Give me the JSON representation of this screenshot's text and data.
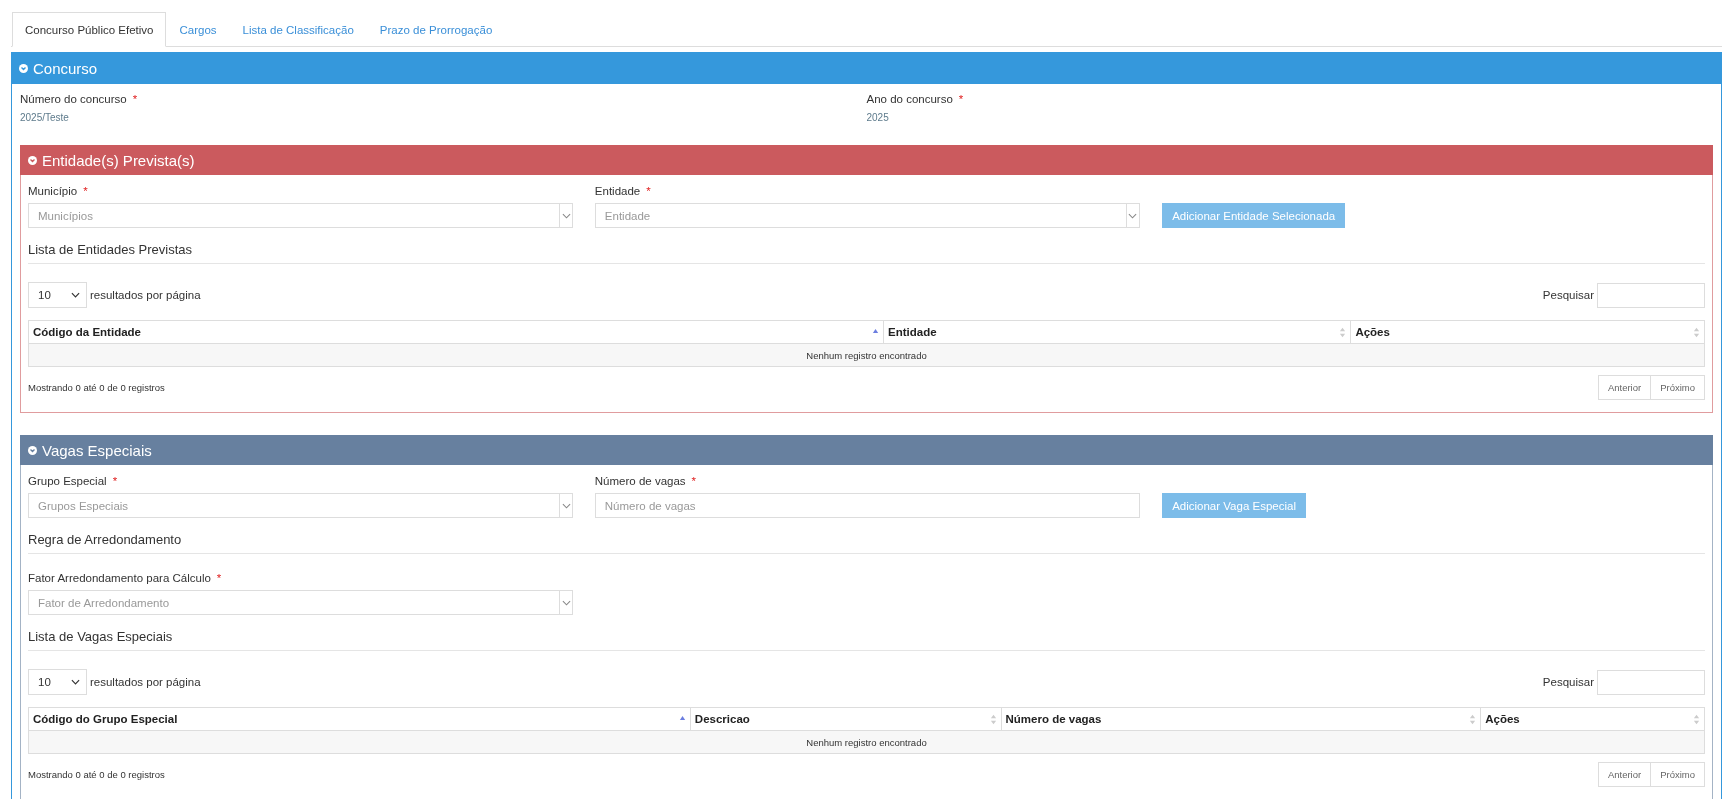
{
  "tabs": [
    {
      "label": "Concurso Público Efetivo",
      "selected": true
    },
    {
      "label": "Cargos",
      "selected": false
    },
    {
      "label": "Lista de Classificação",
      "selected": false
    },
    {
      "label": "Prazo de Prorrogação",
      "selected": false
    }
  ],
  "panel": {
    "title": "Concurso",
    "fields": [
      {
        "label": "Número do concurso",
        "required_mark": "*",
        "value": "2025/Teste"
      },
      {
        "label": "Ano do concurso",
        "required_mark": "*",
        "value": "2025"
      }
    ],
    "subpanels": [
      {
        "title": "Entidade(s) Prevista(s)",
        "color": "#cb5a5e",
        "blocks": [
          {
            "kind": "row",
            "controls": [
              {
                "kind": "select",
                "label": "Município",
                "required_mark": "*",
                "placeholder": "Municípios"
              },
              {
                "kind": "select",
                "label": "Entidade",
                "required_mark": "*",
                "placeholder": "Entidade"
              },
              {
                "kind": "button",
                "label": "Adicionar Entidade Selecionada"
              }
            ]
          },
          {
            "kind": "heading",
            "text": "Lista de Entidades Previstas"
          },
          {
            "kind": "table",
            "page_size": "10",
            "page_size_label": "resultados por página",
            "search_label": "Pesquisar",
            "columns": [
              {
                "label": "Código da Entidade",
                "sorted": true
              },
              {
                "label": "Entidade",
                "sorted": false
              },
              {
                "label": "Ações",
                "sorted": false
              }
            ],
            "empty_message": "Nenhum registro encontrado",
            "info": "Mostrando 0 até 0 de 0 registros",
            "buttons": [
              "Anterior",
              "Próximo"
            ]
          }
        ]
      },
      {
        "title": "Vagas Especiais",
        "color": "#67809f",
        "blocks": [
          {
            "kind": "row",
            "controls": [
              {
                "kind": "select",
                "label": "Grupo Especial",
                "required_mark": "*",
                "placeholder": "Grupos Especiais"
              },
              {
                "kind": "input",
                "label": "Número de vagas",
                "required_mark": "*",
                "placeholder": "Número de vagas"
              },
              {
                "kind": "button",
                "label": "Adicionar Vaga Especial"
              }
            ]
          },
          {
            "kind": "heading",
            "text": "Regra de Arredondamento"
          },
          {
            "kind": "row",
            "controls": [
              {
                "kind": "select",
                "label": "Fator Arredondamento para Cálculo",
                "required_mark": "*",
                "placeholder": "Fator de Arredondamento"
              }
            ]
          },
          {
            "kind": "heading",
            "text": "Lista de Vagas Especiais"
          },
          {
            "kind": "table",
            "page_size": "10",
            "page_size_label": "resultados por página",
            "search_label": "Pesquisar",
            "columns": [
              {
                "label": "Código do Grupo Especial",
                "sorted": true
              },
              {
                "label": "Descricao",
                "sorted": false
              },
              {
                "label": "Número de vagas",
                "sorted": false
              },
              {
                "label": "Ações",
                "sorted": false
              }
            ],
            "empty_message": "Nenhum registro encontrado",
            "info": "Mostrando 0 até 0 de 0 registros",
            "buttons": [
              "Anterior",
              "Próximo"
            ]
          }
        ]
      }
    ]
  }
}
